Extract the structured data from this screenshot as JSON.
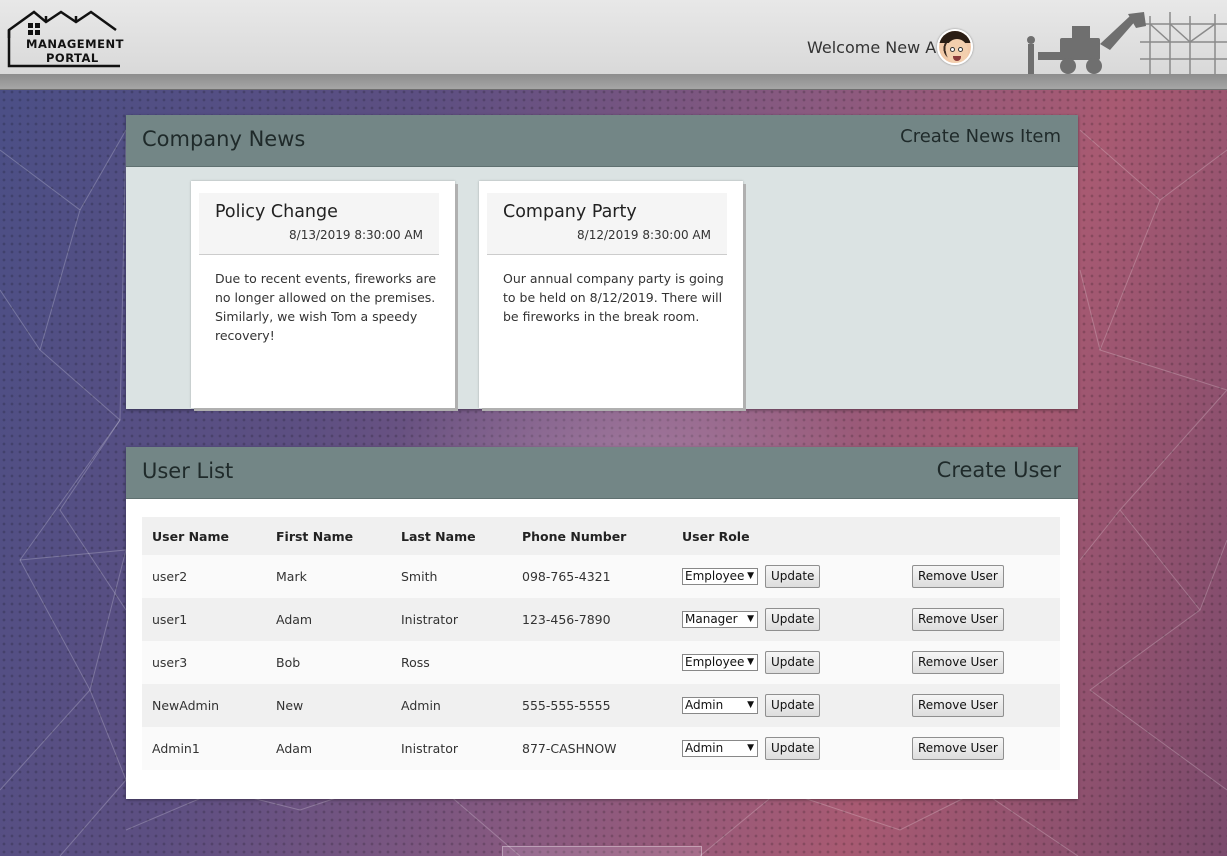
{
  "header": {
    "logo_line1": "MANAGEMENT",
    "logo_line2": "PORTAL",
    "welcome": "Welcome New A"
  },
  "news": {
    "title": "Company News",
    "create_label": "Create News Item",
    "items": [
      {
        "title": "Policy Change",
        "date": "8/13/2019 8:30:00 AM",
        "body": "Due to recent events, fireworks are no longer allowed on the premises. Similarly, we wish Tom a speedy recovery!"
      },
      {
        "title": "Company Party",
        "date": "8/12/2019 8:30:00 AM",
        "body": "Our annual company party is going to be held on 8/12/2019. There will be fireworks in the break room."
      }
    ]
  },
  "users": {
    "title": "User List",
    "create_label": "Create User",
    "columns": [
      "User Name",
      "First Name",
      "Last Name",
      "Phone Number",
      "User Role"
    ],
    "update_label": "Update",
    "remove_label": "Remove User",
    "rows": [
      {
        "username": "user2",
        "first": "Mark",
        "last": "Smith",
        "phone": "098-765-4321",
        "role": "Employee"
      },
      {
        "username": "user1",
        "first": "Adam",
        "last": "Inistrator",
        "phone": "123-456-7890",
        "role": "Manager"
      },
      {
        "username": "user3",
        "first": "Bob",
        "last": "Ross",
        "phone": "",
        "role": "Employee"
      },
      {
        "username": "NewAdmin",
        "first": "New",
        "last": "Admin",
        "phone": "555-555-5555",
        "role": "Admin"
      },
      {
        "username": "Admin1",
        "first": "Adam",
        "last": "Inistrator",
        "phone": "877-CASHNOW",
        "role": "Admin"
      }
    ]
  },
  "colors": {
    "panel_header": "#738686",
    "news_body": "#dbe3e3"
  },
  "icons": [
    "house-logo-icon",
    "avatar",
    "construction-icon",
    "select-arrow-icon"
  ]
}
